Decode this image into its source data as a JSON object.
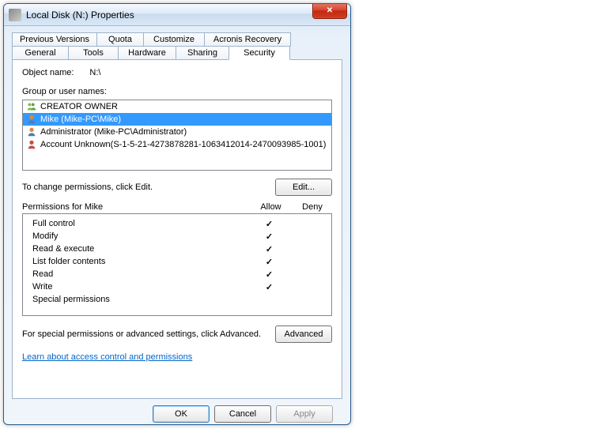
{
  "window": {
    "title": "Local Disk (N:) Properties"
  },
  "tabs": {
    "row1": [
      "Previous Versions",
      "Quota",
      "Customize",
      "Acronis Recovery"
    ],
    "row2": [
      "General",
      "Tools",
      "Hardware",
      "Sharing",
      "Security"
    ],
    "active": "Security"
  },
  "object": {
    "label": "Object name:",
    "value": "N:\\"
  },
  "groups": {
    "label": "Group or user names:",
    "items": [
      {
        "name": "CREATOR OWNER",
        "type": "group",
        "selected": false
      },
      {
        "name": "Mike (Mike-PC\\Mike)",
        "type": "user",
        "selected": true
      },
      {
        "name": "Administrator (Mike-PC\\Administrator)",
        "type": "user",
        "selected": false
      },
      {
        "name": "Account Unknown(S-1-5-21-4273878281-1063412014-2470093985-1001)",
        "type": "unknown",
        "selected": false
      }
    ]
  },
  "edit_hint": "To change permissions, click Edit.",
  "edit_button": "Edit...",
  "permissions": {
    "header_for": "Permissions for Mike",
    "col_allow": "Allow",
    "col_deny": "Deny",
    "rows": [
      {
        "name": "Full control",
        "allow": true,
        "deny": false
      },
      {
        "name": "Modify",
        "allow": true,
        "deny": false
      },
      {
        "name": "Read & execute",
        "allow": true,
        "deny": false
      },
      {
        "name": "List folder contents",
        "allow": true,
        "deny": false
      },
      {
        "name": "Read",
        "allow": true,
        "deny": false
      },
      {
        "name": "Write",
        "allow": true,
        "deny": false
      },
      {
        "name": "Special permissions",
        "allow": false,
        "deny": false
      }
    ]
  },
  "advanced_hint": "For special permissions or advanced settings, click Advanced.",
  "advanced_button": "Advanced",
  "help_link": "Learn about access control and permissions",
  "buttons": {
    "ok": "OK",
    "cancel": "Cancel",
    "apply": "Apply"
  }
}
